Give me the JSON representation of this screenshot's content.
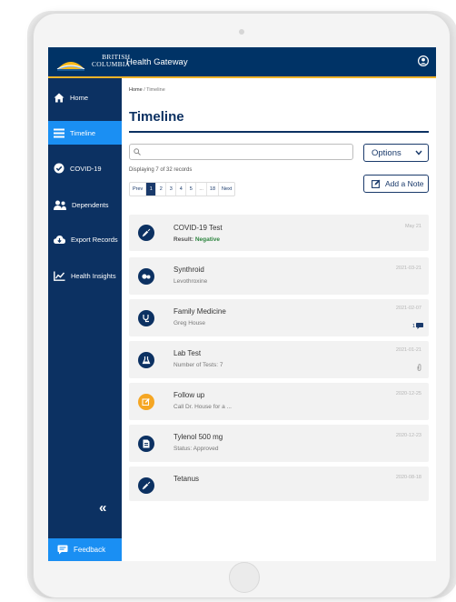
{
  "header": {
    "logo_line1": "BRITISH",
    "logo_line2": "COLUMBIA",
    "app_title": "Health Gateway"
  },
  "sidebar": {
    "items": [
      {
        "label": "Home",
        "icon": "home-icon",
        "active": false
      },
      {
        "label": "Timeline",
        "icon": "list-icon",
        "active": true
      },
      {
        "label": "COVID-19",
        "icon": "check-circle-icon",
        "active": false
      },
      {
        "label": "Dependents",
        "icon": "users-icon",
        "active": false
      },
      {
        "label": "Export Records",
        "icon": "cloud-download-icon",
        "active": false
      },
      {
        "label": "Health Insights",
        "icon": "chart-line-icon",
        "active": false
      }
    ],
    "collapse_label": "«",
    "feedback_label": "Feedback"
  },
  "main": {
    "breadcrumb_home": "Home",
    "breadcrumb_sep": "/",
    "breadcrumb_current": "Timeline",
    "title": "Timeline",
    "search_placeholder": "",
    "options_label": "Options",
    "add_note_label": "Add a Note",
    "displaying_text": "Displaying 7 of 32 records",
    "pagination": [
      "Prev",
      "1",
      "2",
      "3",
      "4",
      "5",
      "...",
      "18",
      "Next"
    ],
    "active_page": "1"
  },
  "entries": [
    {
      "title": "COVID-19 Test",
      "sub_label": "Result:",
      "sub_value": "Negative",
      "date": "May 21",
      "icon": "syringe-icon"
    },
    {
      "title": "Synthroid",
      "sub": "Levothroxine",
      "date": "2021-03-21",
      "icon": "pills-icon"
    },
    {
      "title": "Family Medicine",
      "sub": "Greg House",
      "date": "2021-02-07",
      "badge": "1",
      "icon": "stethoscope-icon"
    },
    {
      "title": "Lab Test",
      "sub": "Number of Tests: 7",
      "date": "2021-01-21",
      "icon": "flask-icon"
    },
    {
      "title": "Follow up",
      "sub": "Call Dr. House for a ...",
      "date": "2020-12-25",
      "icon": "note-edit-icon"
    },
    {
      "title": "Tylenol 500 mg",
      "sub": "Status: Approved",
      "date": "2020-12-23",
      "icon": "prescription-icon"
    },
    {
      "title": "Tetanus",
      "sub": "",
      "date": "2020-08-18",
      "icon": "syringe-icon"
    }
  ],
  "colors": {
    "header_bg": "#003366",
    "sidebar_bg": "#0c3162",
    "accent": "#1a8ff3",
    "gold": "#f0b429",
    "negative_green": "#2e8540",
    "note_orange": "#f5a623"
  }
}
